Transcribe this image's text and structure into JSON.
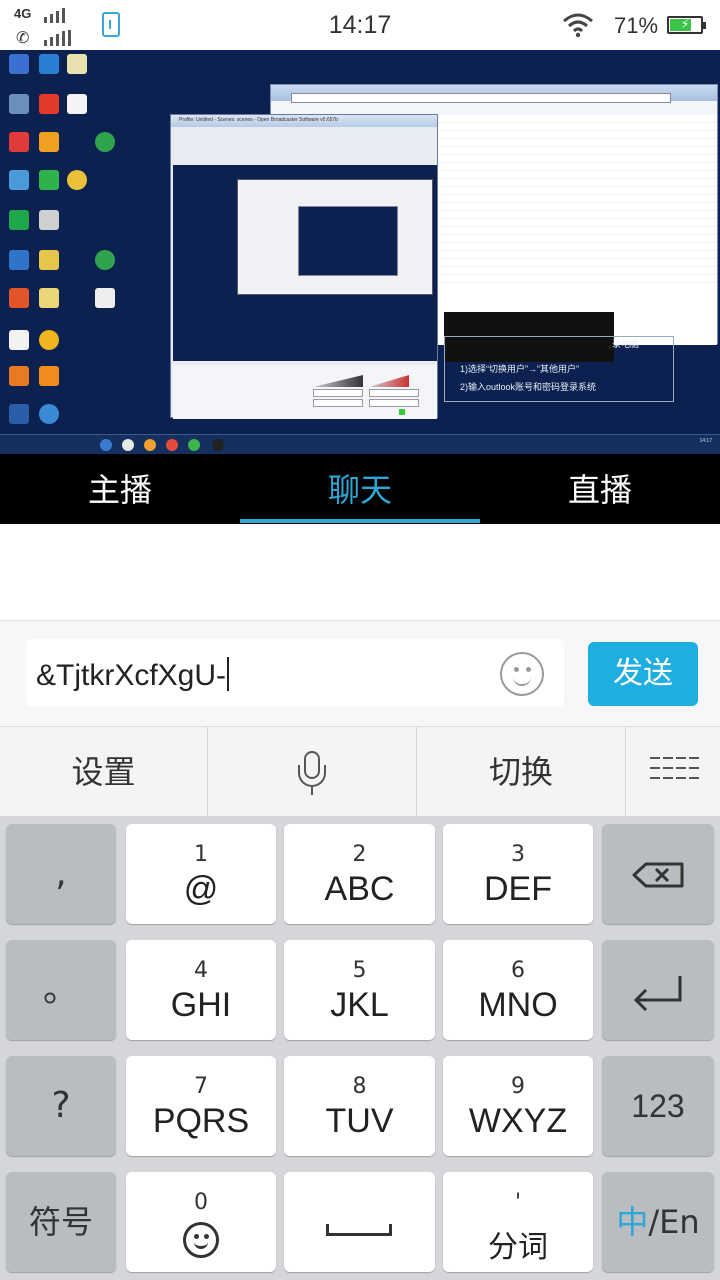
{
  "status_bar": {
    "network": "4G",
    "time": "14:17",
    "battery": "71%",
    "battery_level": 0.71
  },
  "video": {
    "ppt_line1": "1)选择“切换用户”→“其他用户”",
    "ppt_line2": "2)输入outlook账号和密码登录系统",
    "ppt_tail": "录电脑",
    "obs_title": "Profile: Untitled - Scenes: scenes - Open Broadcaster Software v0.657b",
    "taskbar_time": "14:17"
  },
  "tabs": [
    {
      "label": "主播",
      "active": false
    },
    {
      "label": "聊天",
      "active": true
    },
    {
      "label": "直播",
      "active": false
    }
  ],
  "chat_input": {
    "value": "&TjtkrXcfXgU-",
    "send_label": "发送"
  },
  "ime_toolbar": {
    "settings": "设置",
    "switch": "切换"
  },
  "keyboard": {
    "row1": [
      {
        "num": "1",
        "letters": "@"
      },
      {
        "num": "2",
        "letters": "ABC"
      },
      {
        "num": "3",
        "letters": "DEF"
      }
    ],
    "row2": [
      {
        "num": "4",
        "letters": "GHI"
      },
      {
        "num": "5",
        "letters": "JKL"
      },
      {
        "num": "6",
        "letters": "MNO"
      }
    ],
    "row3": [
      {
        "num": "7",
        "letters": "PQRS"
      },
      {
        "num": "8",
        "letters": "TUV"
      },
      {
        "num": "9",
        "letters": "WXYZ"
      }
    ],
    "left_keys": [
      ",",
      "。",
      "?",
      "符号"
    ],
    "key_0": "0",
    "key_comma_word": "'",
    "key_fenci": "分词",
    "key_123": "123",
    "lang_zh": "中",
    "lang_en": "/En"
  }
}
